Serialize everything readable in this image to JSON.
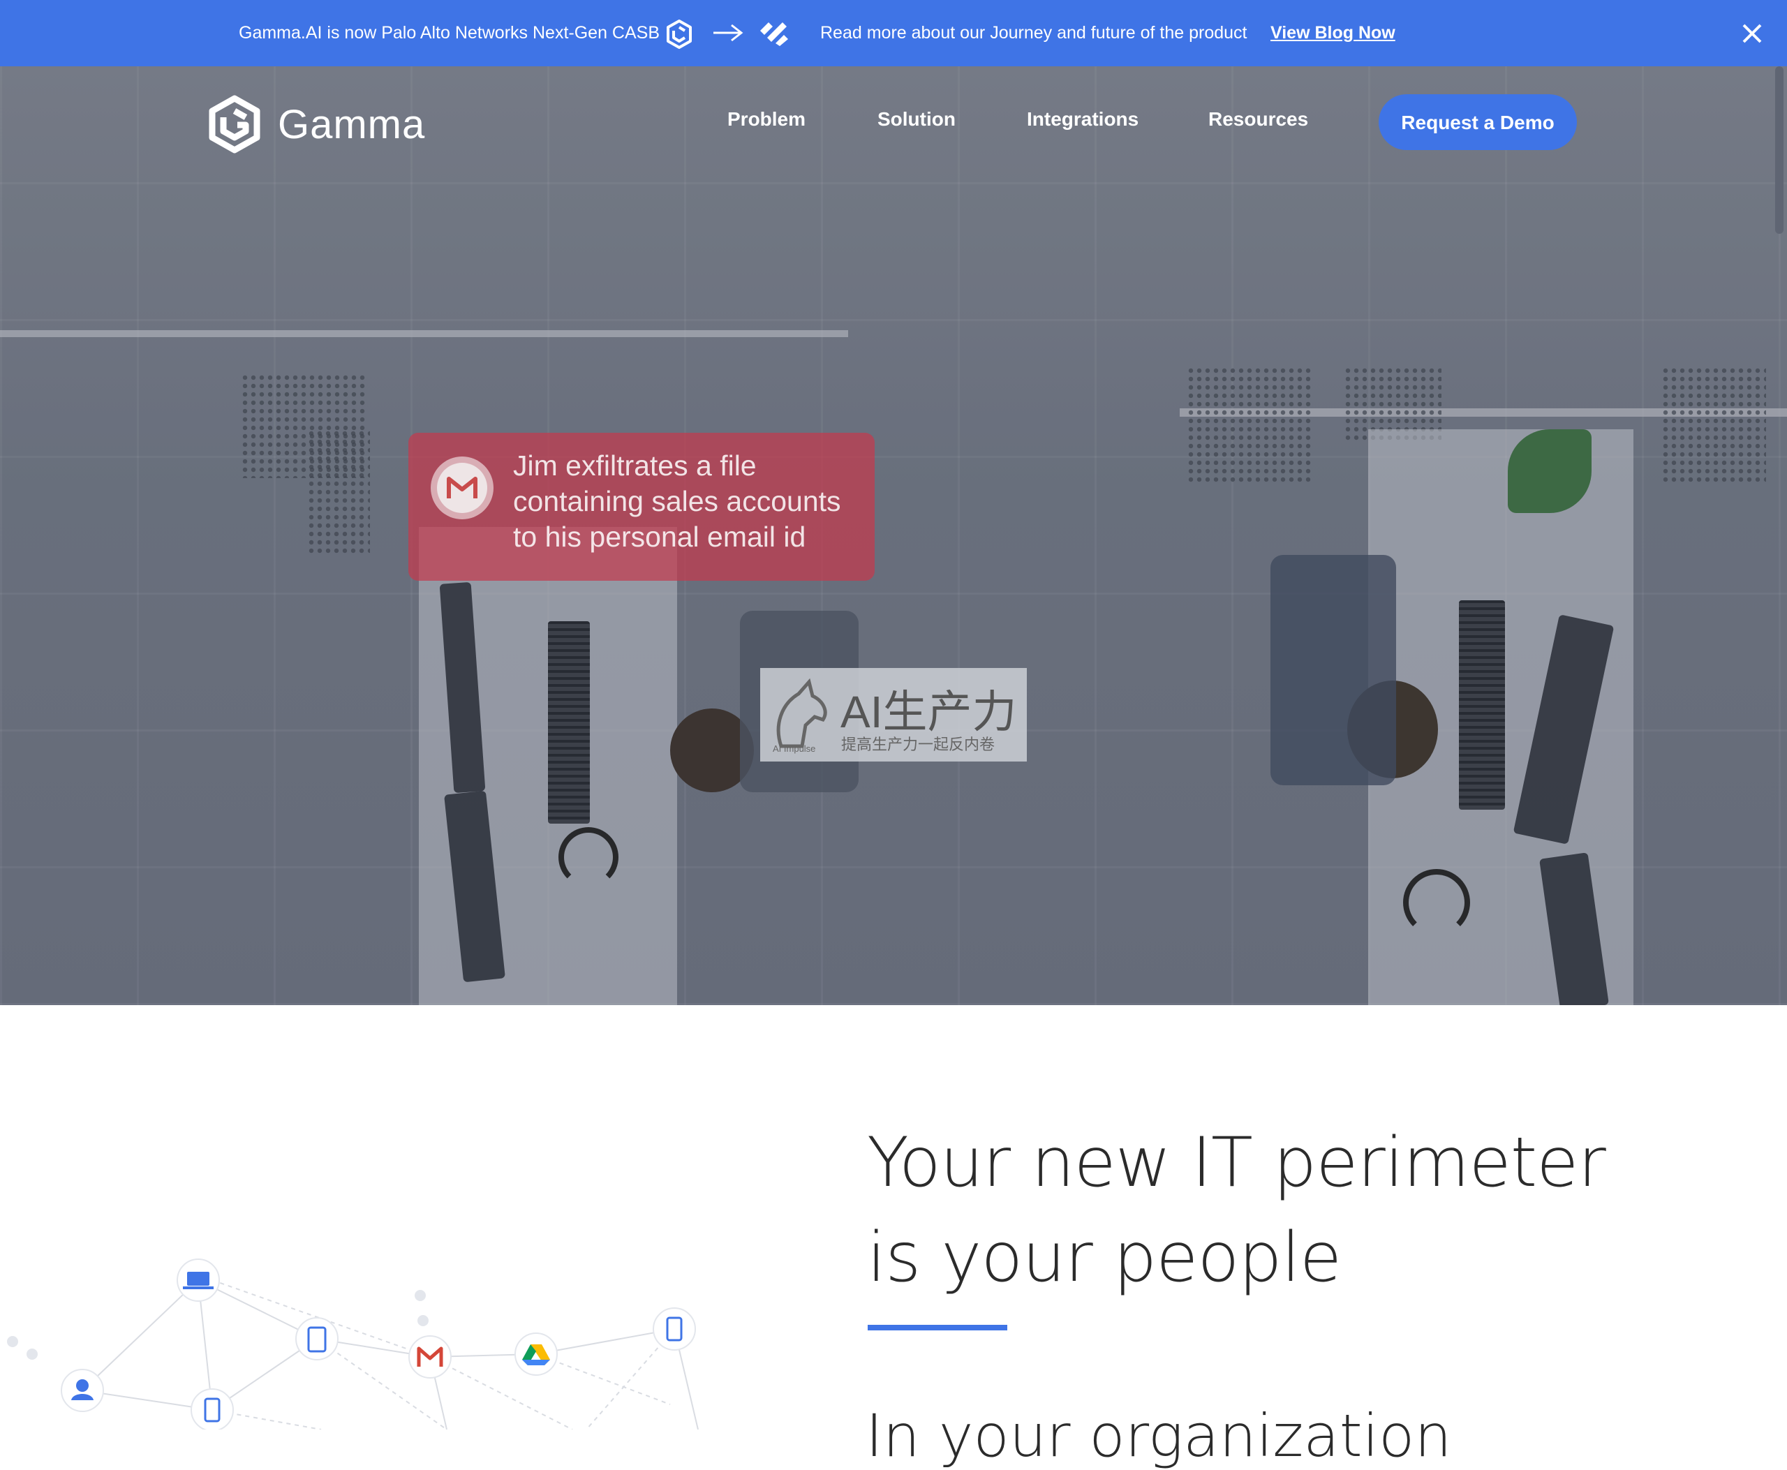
{
  "announcement": {
    "message": "Gamma.AI is now Palo Alto Networks Next-Gen CASB",
    "detail": "Read more about our Journey and future of the product",
    "link_label": "View Blog Now"
  },
  "brand": {
    "name": "Gamma",
    "accent_color": "#3f74e6"
  },
  "nav": {
    "items": [
      {
        "label": "Problem"
      },
      {
        "label": "Solution"
      },
      {
        "label": "Integrations"
      },
      {
        "label": "Resources"
      }
    ],
    "cta_label": "Request a Demo"
  },
  "hero": {
    "alert_text": "Jim exfiltrates a file containing sales accounts to his personal email id",
    "alert_color": "#c43a4e"
  },
  "watermark": {
    "title": "AI生产力",
    "subtitle": "提高生产力一起反内卷",
    "caption": "AI Impulse"
  },
  "section": {
    "headline": "Your new IT perimeter is your people",
    "subheading": "In your organization"
  }
}
